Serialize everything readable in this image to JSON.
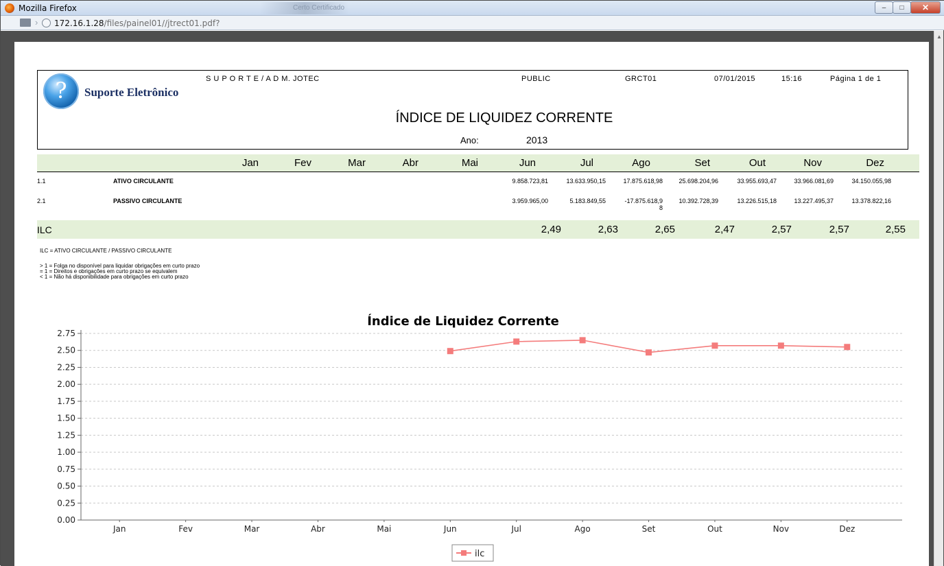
{
  "window": {
    "title": "Mozilla Firefox",
    "bg_tab": "Certo Certificado"
  },
  "url": {
    "host": "172.16.1.28",
    "path": "/files/painel01//jtrect01.pdf?"
  },
  "report": {
    "company": "S U P O R T E /  A D M. JOTEC",
    "brand": "Suporte Eletrônico",
    "visibility": "PUBLIC",
    "code": "GRCT01",
    "date": "07/01/2015",
    "time": "15:16",
    "page": "Página 1 de   1",
    "title": "ÍNDICE DE LIQUIDEZ CORRENTE",
    "year_label": "Ano:",
    "year": "2013"
  },
  "table": {
    "months": [
      "Jan",
      "Fev",
      "Mar",
      "Abr",
      "Mai",
      "Jun",
      "Jul",
      "Ago",
      "Set",
      "Out",
      "Nov",
      "Dez"
    ],
    "rows": [
      {
        "code": "1.1",
        "label": "ATIVO CIRCULANTE",
        "values": [
          "",
          "",
          "",
          "",
          "",
          "9.858.723,81",
          "13.633.950,15",
          "17.875.618,98",
          "25.698.204,96",
          "33.955.693,47",
          "33.966.081,69",
          "34.150.055,98"
        ]
      },
      {
        "code": "2.1",
        "label": "PASSIVO CIRCULANTE",
        "values": [
          "",
          "",
          "",
          "",
          "",
          "3.959.965,00",
          "5.183.849,55",
          "-17.875.618,9",
          "10.392.728,39",
          "13.226.515,18",
          "13.227.495,37",
          "13.378.822,16"
        ],
        "wrap": "8"
      }
    ],
    "ilc_label": "ILC",
    "ilc_values": [
      "",
      "",
      "",
      "",
      "",
      "2,49",
      "2,63",
      "2,65",
      "2,47",
      "2,57",
      "2,57",
      "2,55"
    ]
  },
  "notes": {
    "formula": "ILC = ATIVO CIRCULANTE / PASSIVO CIRCULANTE",
    "lines": [
      "> 1 = Folga no disponível para liquidar obrigações em curto prazo",
      "= 1 = Direitos e obrigações em curto prazo se equivalem",
      "< 1 = Não há disponibilidade para obrigações em curto prazo"
    ]
  },
  "colors": {
    "accent_band": "#e4f0d8",
    "series": "#f47c7c"
  },
  "chart_data": {
    "type": "line",
    "title": "Índice de Liquidez Corrente",
    "categories": [
      "Jan",
      "Fev",
      "Mar",
      "Abr",
      "Mai",
      "Jun",
      "Jul",
      "Ago",
      "Set",
      "Out",
      "Nov",
      "Dez"
    ],
    "series": [
      {
        "name": "ilc",
        "values": [
          null,
          null,
          null,
          null,
          null,
          2.49,
          2.63,
          2.65,
          2.47,
          2.57,
          2.57,
          2.55
        ]
      }
    ],
    "ylim": [
      0,
      2.75
    ],
    "yticks": [
      "0.00",
      "0.25",
      "0.50",
      "0.75",
      "1.00",
      "1.25",
      "1.50",
      "1.75",
      "2.00",
      "2.25",
      "2.50",
      "2.75"
    ],
    "grid": true,
    "legend": "bottom-center"
  }
}
